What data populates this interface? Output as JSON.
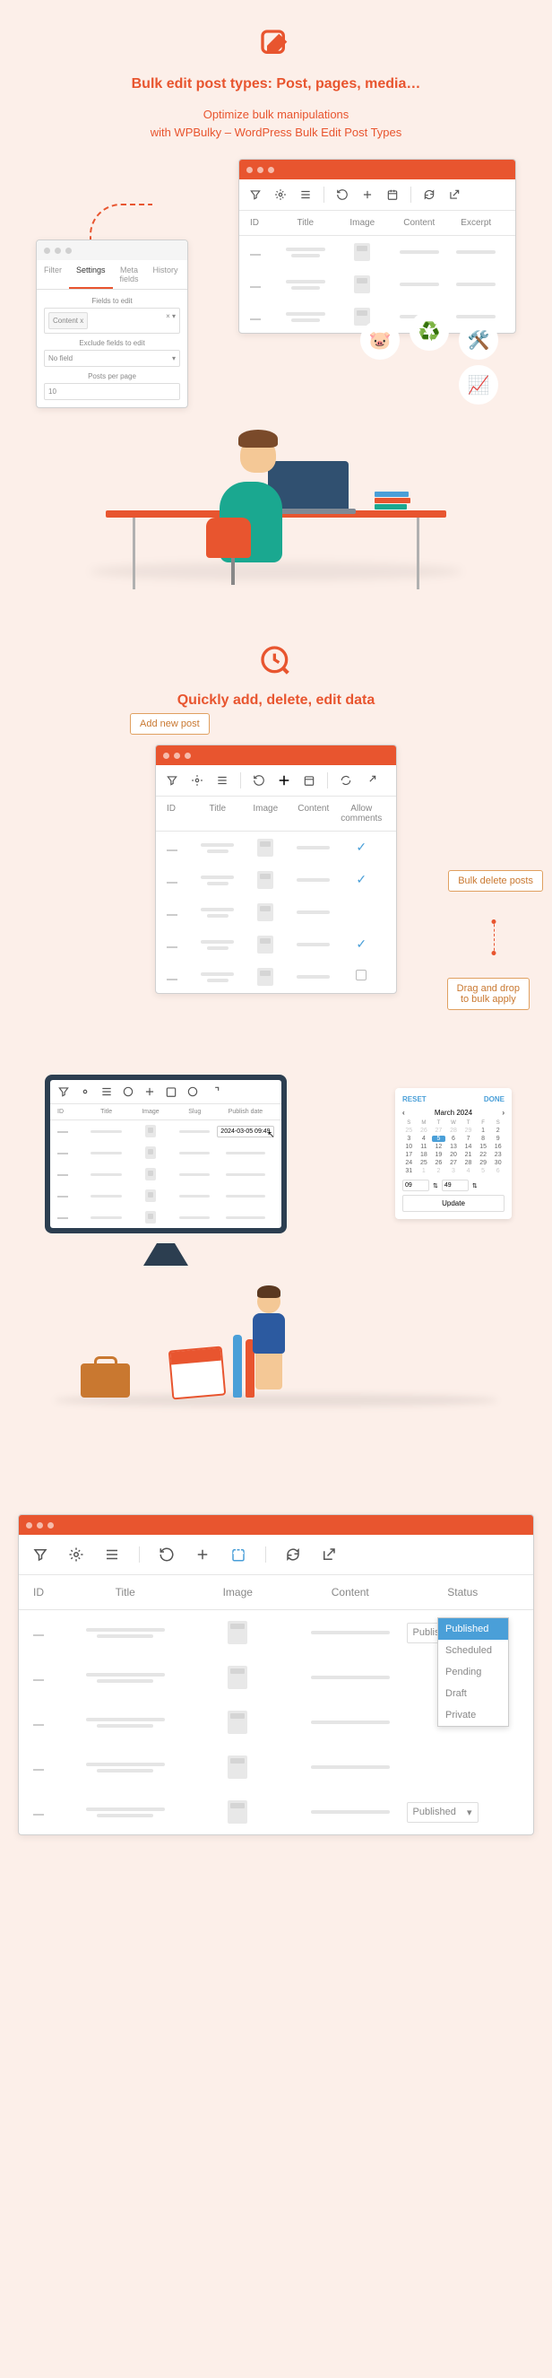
{
  "section1": {
    "title": "Bulk edit post types: Post, pages, media…",
    "subtitle_l1": "Optimize bulk manipulations",
    "subtitle_l2": "with WPBulky – WordPress Bulk Edit Post Types",
    "win1_cols": [
      "ID",
      "Title",
      "Image",
      "Content",
      "Excerpt"
    ],
    "win2_tabs": [
      "Filter",
      "Settings",
      "Meta fields",
      "History"
    ],
    "form": {
      "f1_label": "Fields to edit",
      "f1_value": "Content x",
      "f2_label": "Exclude fields to edit",
      "f2_value": "No field",
      "f3_label": "Posts per page",
      "f3_value": "10"
    }
  },
  "section2": {
    "title": "Quickly add, delete, edit data",
    "callout1": "Add new post",
    "callout2": "Bulk delete posts",
    "callout3_l1": "Drag and drop",
    "callout3_l2": "to bulk apply",
    "cols": [
      "ID",
      "Title",
      "Image",
      "Content",
      "Allow comments"
    ]
  },
  "section3": {
    "cols": [
      "ID",
      "Title",
      "Image",
      "Slug",
      "Publish date"
    ],
    "date_value": "2024-03-05 09:49",
    "cal": {
      "reset": "RESET",
      "done": "DONE",
      "month": "March 2024",
      "days": [
        "S",
        "M",
        "T",
        "W",
        "T",
        "F",
        "S"
      ],
      "hour": "09",
      "min": "49",
      "update": "Update"
    }
  },
  "section4": {
    "cols": [
      "ID",
      "Title",
      "Image",
      "Content",
      "Status"
    ],
    "status_value": "Published",
    "options": [
      "Published",
      "Scheduled",
      "Pending",
      "Draft",
      "Private"
    ]
  }
}
